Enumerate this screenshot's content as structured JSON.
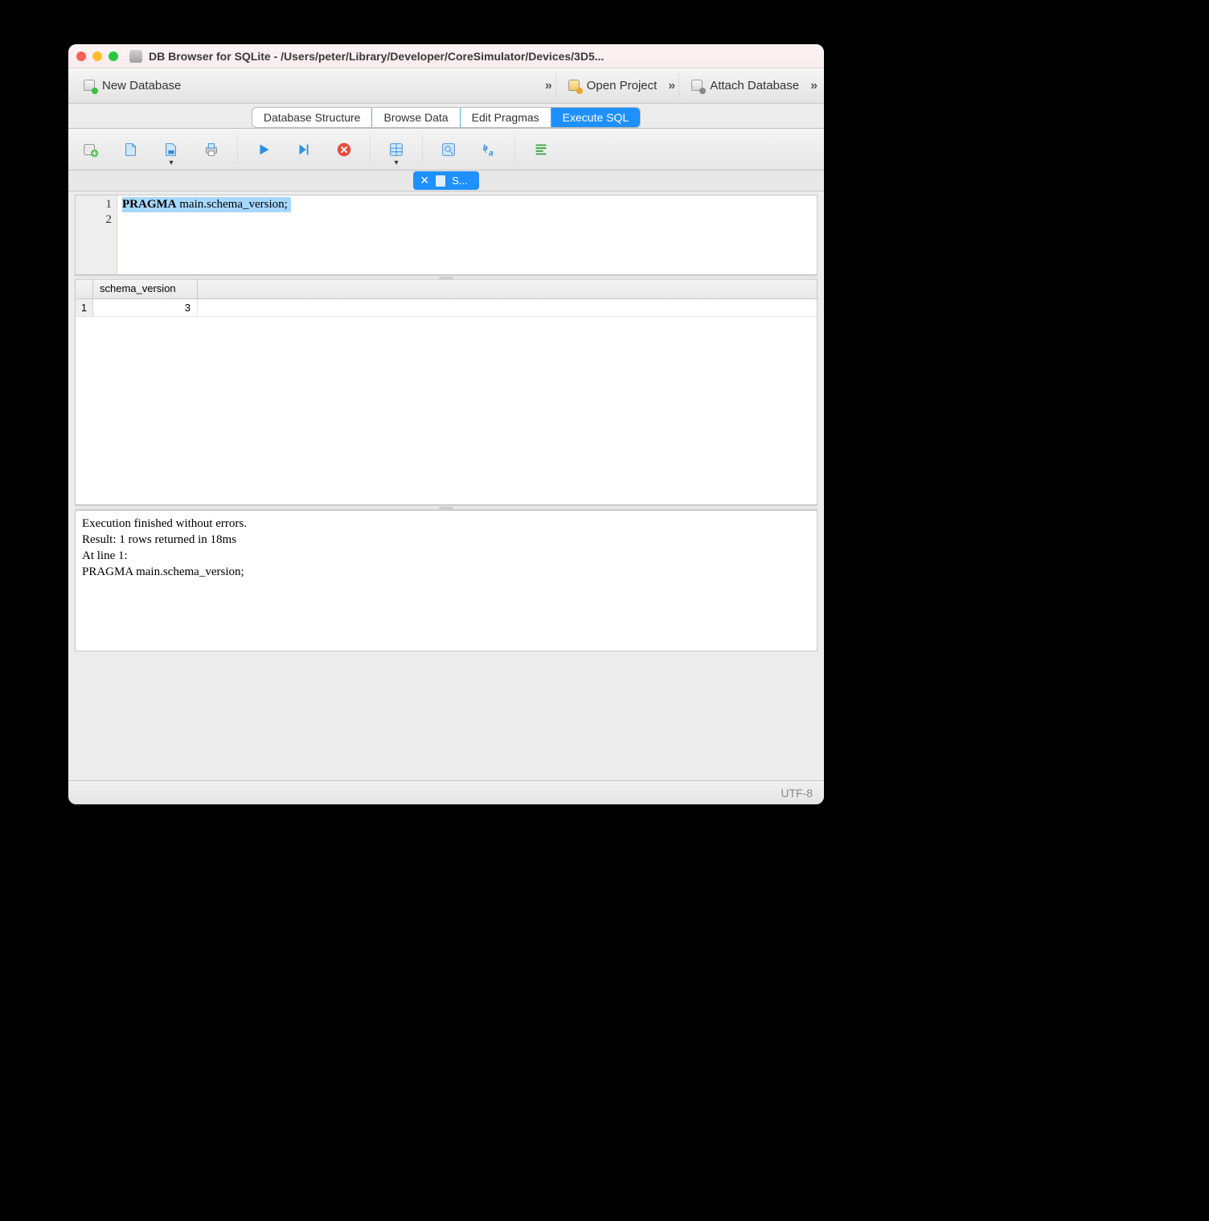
{
  "window": {
    "title": "DB Browser for SQLite - /Users/peter/Library/Developer/CoreSimulator/Devices/3D5..."
  },
  "toolbar": {
    "new_db": "New Database",
    "open_project": "Open Project",
    "attach_db": "Attach Database"
  },
  "tabs": {
    "structure": "Database Structure",
    "browse": "Browse Data",
    "pragmas": "Edit Pragmas",
    "execute": "Execute SQL"
  },
  "editor_tab": {
    "label": "S..."
  },
  "editor": {
    "lines": [
      "1",
      "2"
    ],
    "keyword": "PRAGMA",
    "rest": " main.schema_version;"
  },
  "results": {
    "column": "schema_version",
    "row_num": "1",
    "value": "3"
  },
  "log": {
    "line1": "Execution finished without errors.",
    "line2": "Result: 1 rows returned in 18ms",
    "line3": "At line 1:",
    "line4": "PRAGMA main.schema_version;"
  },
  "status": {
    "encoding": "UTF-8"
  }
}
